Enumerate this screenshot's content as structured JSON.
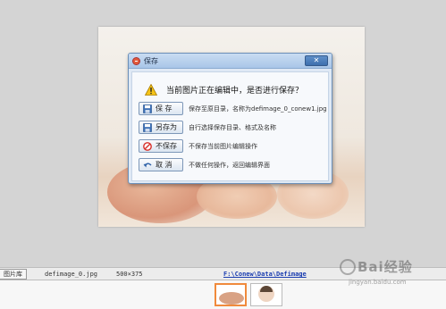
{
  "dialog": {
    "title": "保存",
    "close_label": "✕",
    "question": "当前图片正在编辑中，是否进行保存？",
    "options": [
      {
        "label": "保  存",
        "icon": "floppy-disk-icon",
        "description": "保存至原目录，名称为defimage_0_conew1.jpg"
      },
      {
        "label": "另存为",
        "icon": "floppy-disk-icon",
        "description": "自行选择保存目录、格式及名称"
      },
      {
        "label": "不保存",
        "icon": "no-entry-icon",
        "description": "不保存当前图片编辑操作"
      },
      {
        "label": "取  消",
        "icon": "undo-arrow-icon",
        "description": "不做任何操作，返回编辑界面"
      }
    ]
  },
  "statusbar": {
    "library_tab": "图片库",
    "filename": "defimage_0.jpg",
    "dimensions": "500×375",
    "path": "F:\\Conew\\Data\\Defimage"
  },
  "watermark": {
    "main": "Bai经验",
    "sub": "jingyan.baidu.com"
  },
  "colors": {
    "accent": "#f08a3c",
    "dialog_bg": "#dfe9f5",
    "link": "#1a3db0"
  }
}
